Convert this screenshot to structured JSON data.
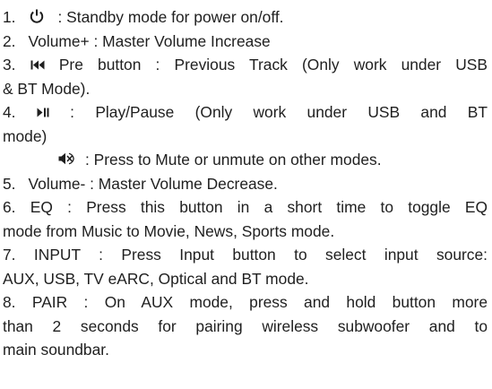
{
  "items": [
    {
      "num": "1.",
      "text": ": Standby mode for power on/off.",
      "icon": "power-icon"
    },
    {
      "num": "2.",
      "text": "Volume+ : Master Volume Increase"
    },
    {
      "num": "3.",
      "icon": "previous-track-icon",
      "line1": "Pre button : Previous Track (Only work under USB",
      "line2": "& BT Mode)."
    },
    {
      "num": "4.",
      "icon": "play-pause-icon",
      "line1": ": Play/Pause (Only work under USB and BT",
      "line2": "mode)"
    },
    {
      "icon": "mute-icon",
      "text": ": Press to Mute or unmute on other modes."
    },
    {
      "num": "5.",
      "text": "Volume- : Master Volume Decrease."
    },
    {
      "num": "6.",
      "line1": "EQ : Press this button in a short time to toggle EQ",
      "line2": "mode from Music to Movie, News, Sports mode."
    },
    {
      "num": "7.",
      "line1": "INPUT : Press Input button to select input source:",
      "line2": "AUX, USB, TV eARC, Optical and BT mode."
    },
    {
      "num": "8.",
      "line1": "PAIR : On AUX mode, press and hold button more",
      "line2": "than 2 seconds for pairing wireless subwoofer and to",
      "line3": "main soundbar."
    }
  ]
}
